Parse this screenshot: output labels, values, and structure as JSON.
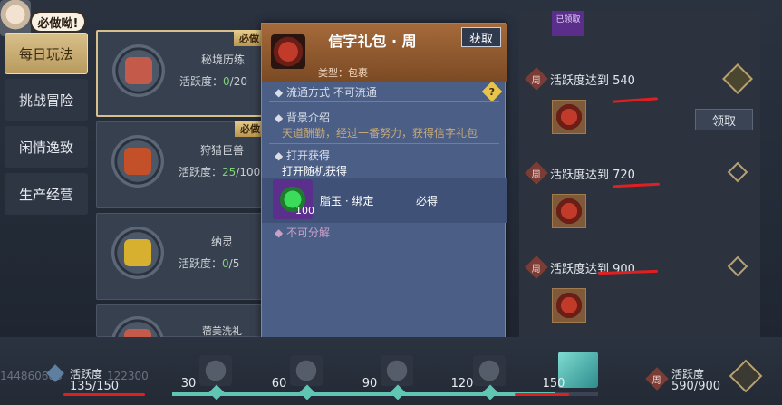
{
  "header": {
    "bubble_text": "必做呦!"
  },
  "menu": {
    "items": [
      {
        "label": "每日玩法",
        "active": true
      },
      {
        "label": "挑战冒险",
        "active": false
      },
      {
        "label": "闲情逸致",
        "active": false
      },
      {
        "label": "生产经营",
        "active": false
      }
    ]
  },
  "activities": [
    {
      "name": "秘境历练",
      "prog_label": "活跃度：",
      "current": "0",
      "total": "/20",
      "badge": "必做",
      "color": "#c45b4a"
    },
    {
      "name": "狩猎巨兽",
      "prog_label": "活跃度：",
      "current": "25",
      "total": "/100",
      "badge": "必做",
      "color": "#c4502a"
    },
    {
      "name": "纳灵",
      "prog_label": "活跃度：",
      "current": "0",
      "total": "/5",
      "badge": "",
      "color": "#d8b030"
    },
    {
      "name": "蓿美洗礼",
      "prog_label": "",
      "current": "",
      "total": "",
      "badge": "",
      "color": "#c45b4a"
    }
  ],
  "popup": {
    "title": "信字礼包 · 周",
    "get_button": "获取",
    "type_text": "类型：包裹",
    "circulation": "流通方式   不可流通",
    "bg_label": "背景介绍",
    "bg_text": "天道酬勤，经过一番努力，获得信字礼包",
    "open_label": "打开获得",
    "open_text": "打开随机获得",
    "reward": {
      "name": "脂玉 · 绑定",
      "qty": "100",
      "tag": "必得"
    },
    "not_split": "不可分解",
    "help_icon": "question-icon"
  },
  "right_panel": {
    "claimed_tag": "已领取",
    "zhou": "周",
    "claim_button": "领取",
    "tiers": [
      {
        "label": "活跃度达到 540"
      },
      {
        "label": "活跃度达到 720"
      },
      {
        "label": "活跃度达到 900"
      }
    ]
  },
  "bottom": {
    "daily_label": "活跃度",
    "daily_value": "135/150",
    "id_left": "144860683",
    "id_right": "122300",
    "milestones": [
      "30",
      "60",
      "90",
      "120",
      "150"
    ],
    "progress_fraction": 0.9,
    "weekly_label": "活跃度",
    "weekly_value": "590/900",
    "zhou": "周"
  },
  "colors": {
    "accent_gold": "#d8c08a",
    "progress_teal": "#5fc6b4",
    "annotation_red": "#e02020"
  }
}
